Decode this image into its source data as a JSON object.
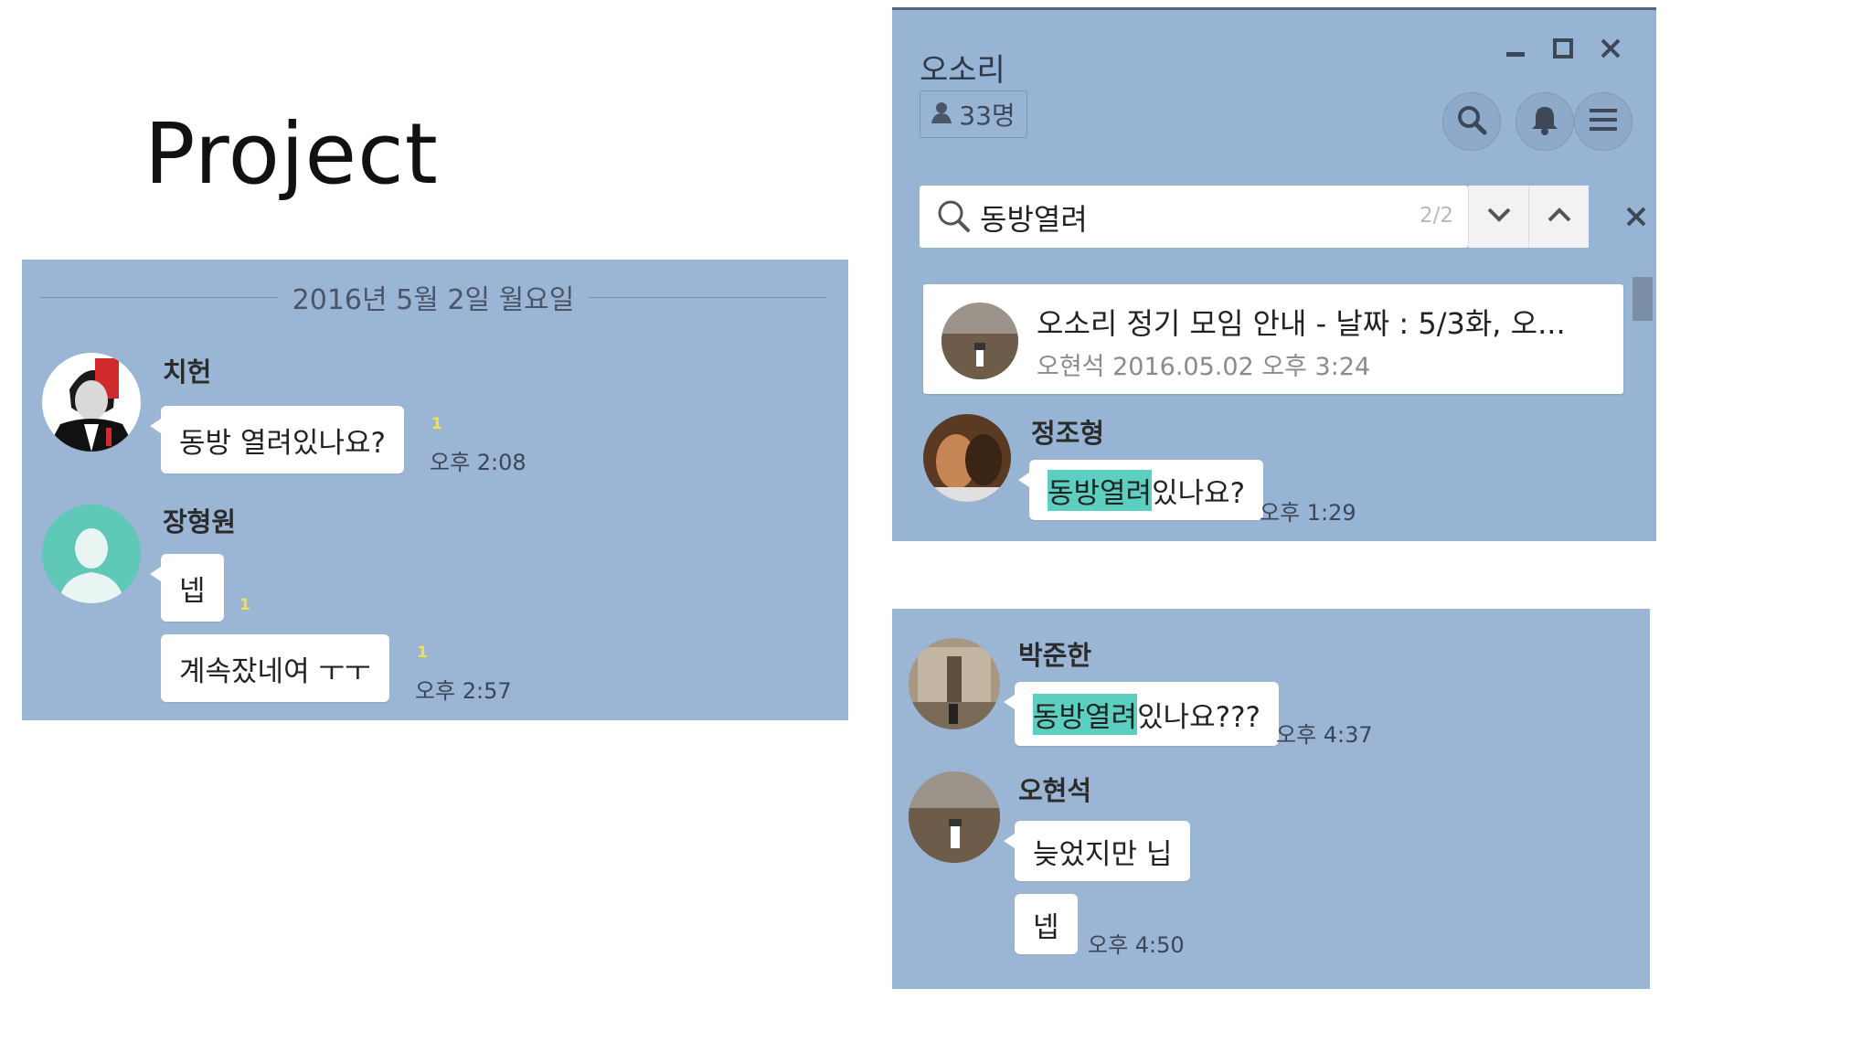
{
  "slide": {
    "title": "Project"
  },
  "chat_a": {
    "date": "2016년 5월 2일 월요일",
    "messages": [
      {
        "sender": "치헌",
        "bubbles": [
          "동방 열려있나요?"
        ],
        "unread": "1",
        "time": "오후 2:08"
      },
      {
        "sender": "장형원",
        "bubbles": [
          "넵",
          "계속잤네여 ㅜㅜ"
        ],
        "unread": [
          "1",
          "1"
        ],
        "time": "오후 2:57"
      }
    ]
  },
  "chat_b": {
    "room_name": "오소리",
    "member_count": "33명",
    "search": {
      "query": "동방열려",
      "result_count": "2/2"
    },
    "notice": {
      "title": "오소리 정기 모임 안내 - 날짜 : 5/3화, 오...",
      "meta": "오현석 2016.05.02 오후 3:24"
    },
    "message": {
      "sender": "정조형",
      "highlight": "동방열려",
      "rest": "있나요?",
      "time": "오후 1:29"
    },
    "icons": {
      "minimize": "minimize-icon",
      "maximize": "maximize-icon",
      "close": "close-icon",
      "search": "search-icon",
      "bell": "bell-icon",
      "menu": "menu-icon",
      "down": "chevron-down-icon",
      "up": "chevron-up-icon",
      "member": "person-icon"
    }
  },
  "chat_c": {
    "messages": [
      {
        "sender": "박준한",
        "highlight": "동방열려",
        "rest": "있나요???",
        "time": "오후 4:37"
      },
      {
        "sender": "오현석",
        "bubbles": [
          "늦었지만 닙",
          "넵"
        ],
        "time": "오후 4:50"
      }
    ]
  },
  "colors": {
    "chat_bg": "#9bb5d5",
    "bubble": "#ffffff",
    "highlight": "#5ccfc0",
    "unread": "#f5e04a"
  }
}
